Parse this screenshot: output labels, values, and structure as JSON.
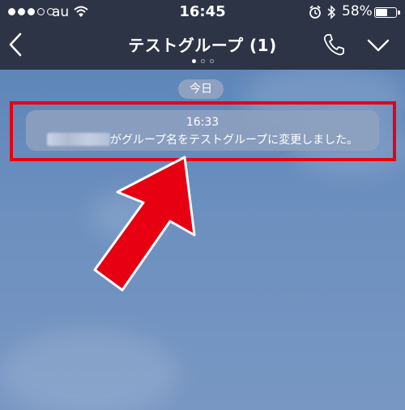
{
  "status_bar": {
    "carrier": "au",
    "time": "16:45",
    "battery_percent": "58%",
    "battery_level": 0.58,
    "signal_bars_filled": 3,
    "signal_bars_total": 5
  },
  "header": {
    "title": "テストグループ (1)",
    "page_dots_total": 3,
    "page_dot_active": 1
  },
  "chat": {
    "date_label": "今日",
    "system_message": {
      "time": "16:33",
      "text": "がグループ名をテストグループに変更しました。"
    }
  },
  "annotation": {
    "highlight_color": "#e60012",
    "arrow_color": "#e60012"
  }
}
